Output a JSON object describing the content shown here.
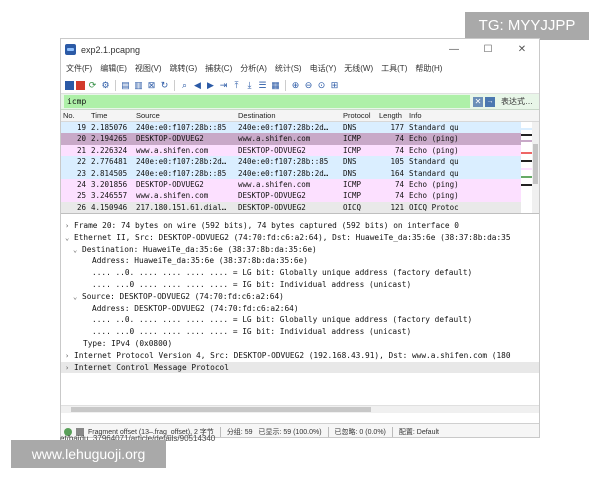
{
  "watermarks": {
    "top_right": "TG: MYYJJPP",
    "bottom_left": "www.lehuguoji.org"
  },
  "window": {
    "title": "exp2.1.pcapng",
    "controls": [
      "—",
      "☐",
      "✕"
    ]
  },
  "menu": [
    "文件(F)",
    "编辑(E)",
    "视图(V)",
    "跳转(G)",
    "捕获(C)",
    "分析(A)",
    "统计(S)",
    "电话(Y)",
    "无线(W)",
    "工具(T)",
    "帮助(H)"
  ],
  "filter": {
    "value": "icmp",
    "expression_label": "表达式…",
    "clear_icon": "✕",
    "apply_icon": "→"
  },
  "packet_list": {
    "columns": [
      "No.",
      "Time",
      "Source",
      "Destination",
      "Protocol",
      "Length",
      "Info"
    ],
    "rows": [
      {
        "no": "19",
        "time": "2.185076",
        "src": "240e:e0:f107:28b::85",
        "dst": "240e:e0:f107:28b:2d…",
        "proto": "DNS",
        "len": "177",
        "info": "Standard qu"
      },
      {
        "no": "20",
        "time": "2.194265",
        "src": "DESKTOP-ODVUEG2",
        "dst": "www.a.shifen.com",
        "proto": "ICMP",
        "len": "74",
        "info": "Echo (ping)"
      },
      {
        "no": "21",
        "time": "2.226324",
        "src": "www.a.shifen.com",
        "dst": "DESKTOP-ODVUEG2",
        "proto": "ICMP",
        "len": "74",
        "info": "Echo (ping)"
      },
      {
        "no": "22",
        "time": "2.776481",
        "src": "240e:e0:f107:28b:2d…",
        "dst": "240e:e0:f107:28b::85",
        "proto": "DNS",
        "len": "105",
        "info": "Standard qu"
      },
      {
        "no": "23",
        "time": "2.814505",
        "src": "240e:e0:f107:28b::85",
        "dst": "240e:e0:f107:28b:2d…",
        "proto": "DNS",
        "len": "164",
        "info": "Standard qu"
      },
      {
        "no": "24",
        "time": "3.201856",
        "src": "DESKTOP-ODVUEG2",
        "dst": "www.a.shifen.com",
        "proto": "ICMP",
        "len": "74",
        "info": "Echo (ping)"
      },
      {
        "no": "25",
        "time": "3.246557",
        "src": "www.a.shifen.com",
        "dst": "DESKTOP-ODVUEG2",
        "proto": "ICMP",
        "len": "74",
        "info": "Echo (ping)"
      },
      {
        "no": "26",
        "time": "4.150946",
        "src": "217.180.151.61.dial…",
        "dst": "DESKTOP-ODVUEG2",
        "proto": "OICQ",
        "len": "121",
        "info": "OICQ Protoc"
      }
    ]
  },
  "details": [
    "Frame 20: 74 bytes on wire (592 bits), 74 bytes captured (592 bits) on interface 0",
    "Ethernet II, Src: DESKTOP-ODVUEG2 (74:70:fd:c6:a2:64), Dst: HuaweiTe_da:35:6e (38:37:8b:da:35",
    "Destination: HuaweiTe_da:35:6e (38:37:8b:da:35:6e)",
    "Address: HuaweiTe_da:35:6e (38:37:8b:da:35:6e)",
    ".... ..0. .... .... .... .... = LG bit: Globally unique address (factory default)",
    ".... ...0 .... .... .... .... = IG bit: Individual address (unicast)",
    "Source: DESKTOP-ODVUEG2 (74:70:fd:c6:a2:64)",
    "Address: DESKTOP-ODVUEG2 (74:70:fd:c6:a2:64)",
    ".... ..0. .... .... .... .... = LG bit: Globally unique address (factory default)",
    ".... ...0 .... .... .... .... = IG bit: Individual address (unicast)",
    "Type: IPv4 (0x0800)",
    "Internet Protocol Version 4, Src: DESKTOP-ODVUEG2 (192.168.43.91), Dst: www.a.shifen.com (180",
    "Internet Control Message Protocol"
  ],
  "status": {
    "field": "Fragment offset (13–.frag_offset), 2 字节",
    "group": "分组: 59",
    "shown": "已显示: 59 (100.0%)",
    "loaded": "已忽略: 0 (0.0%)",
    "profile": "配置: Default"
  },
  "below_text": "et/baidu_37964071/article/details/90514340",
  "icons": {
    "app": "wireshark-fin-icon",
    "arrow_collapsed": "›",
    "arrow_expanded": "⌄"
  }
}
